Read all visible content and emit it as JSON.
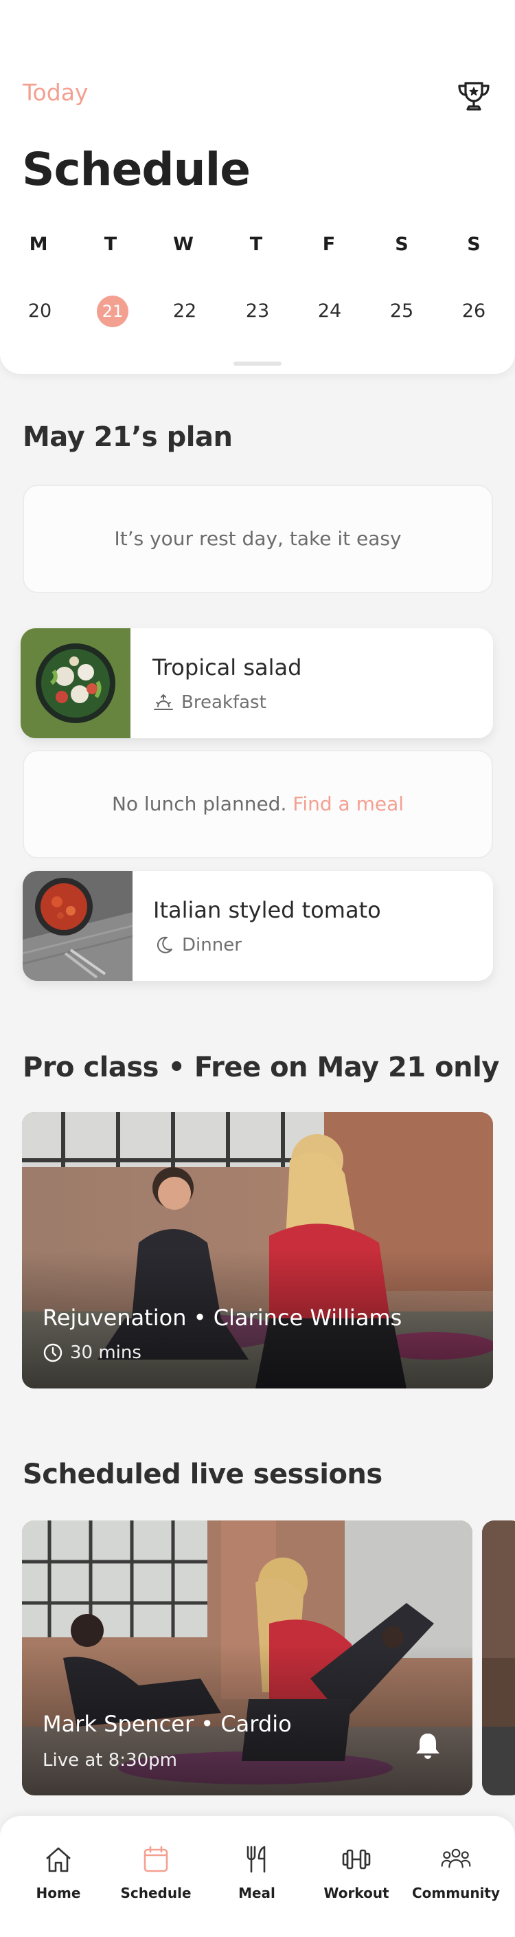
{
  "header": {
    "today_label": "Today",
    "title": "Schedule",
    "week": [
      {
        "dow": "M",
        "date": "20"
      },
      {
        "dow": "T",
        "date": "21"
      },
      {
        "dow": "W",
        "date": "22"
      },
      {
        "dow": "T",
        "date": "23"
      },
      {
        "dow": "F",
        "date": "24"
      },
      {
        "dow": "S",
        "date": "25"
      },
      {
        "dow": "S",
        "date": "26"
      }
    ],
    "selected_date": "21"
  },
  "plan": {
    "title": "May 21’s plan",
    "rest_day_text": "It’s your rest day, take it easy",
    "meals": [
      {
        "name": "Tropical salad",
        "meal_type": "Breakfast",
        "icon": "sunrise-icon"
      },
      {
        "name": "Italian styled tomato",
        "meal_type": "Dinner",
        "icon": "moon-icon"
      }
    ],
    "no_lunch_text": "No lunch planned.",
    "find_meal_link": "Find a meal"
  },
  "pro_class": {
    "title": "Pro class • Free on May 21 only",
    "class_title": "Rejuvenation • Clarince Williams",
    "duration": "30 mins"
  },
  "live": {
    "title": "Scheduled live sessions",
    "sessions": [
      {
        "title": "Mark Spencer • Cardio",
        "time": "Live at 8:30pm"
      }
    ]
  },
  "tabbar": {
    "tabs": [
      {
        "label": "Home",
        "icon": "home-icon"
      },
      {
        "label": "Schedule",
        "icon": "calendar-icon"
      },
      {
        "label": "Meal",
        "icon": "utensils-icon"
      },
      {
        "label": "Workout",
        "icon": "dumbbell-icon"
      },
      {
        "label": "Community",
        "icon": "community-icon"
      }
    ],
    "active": "Schedule"
  },
  "colors": {
    "accent": "#f4a091",
    "text": "#2b2b2b",
    "background": "#f4f4f4"
  }
}
